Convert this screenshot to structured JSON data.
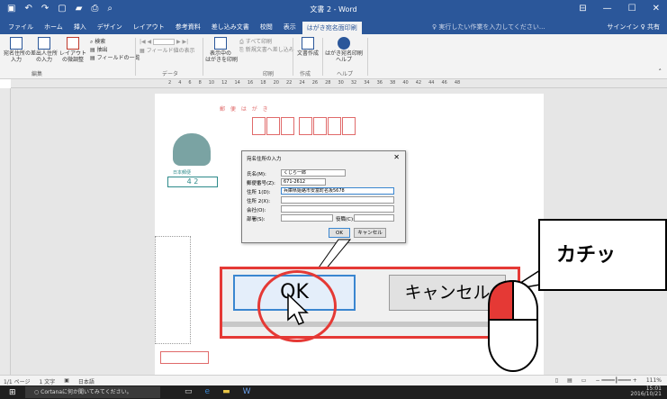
{
  "window": {
    "title": "文書 2 - Word",
    "controls": [
      "⊟",
      "—",
      "☐",
      "✕"
    ]
  },
  "menu": {
    "tabs": [
      "ファイル",
      "ホーム",
      "挿入",
      "デザイン",
      "レイアウト",
      "参考資料",
      "差し込み文書",
      "校閲",
      "表示",
      "はがき宛名面印刷"
    ],
    "active_index": 9,
    "tellme": "♀ 実行したい作業を入力してください...",
    "signin": "サインイン",
    "share": "♀ 共有"
  },
  "ribbon": {
    "btn_address": "宛名住所の\n入力",
    "btn_sender": "差出人住所\nの入力",
    "btn_layout": "レイアウト\nの微調整",
    "search": "検索",
    "extract": "抽出",
    "field_all": "フィールドの一覧",
    "field_display": "フィールド値の表示",
    "show_cards": "表示中の\nはがきを印刷",
    "print_all": "すべて印刷",
    "print_new": "新規文書へ差し込み",
    "doc_create": "文書作成",
    "help": "はがき宛名印刷\nヘルプ",
    "groups": {
      "edit": "編集",
      "data": "データ",
      "print": "印刷",
      "create": "作成",
      "helpg": "ヘルプ"
    }
  },
  "ruler": {
    "ticks": [
      "2",
      "4",
      "6",
      "8",
      "10",
      "12",
      "14",
      "16",
      "18",
      "20",
      "22",
      "24",
      "26",
      "28",
      "30",
      "32",
      "34",
      "36",
      "38",
      "40",
      "42",
      "44",
      "46",
      "48"
    ]
  },
  "page": {
    "postal_label": "郵 便 は が き",
    "stamp_label": "",
    "logo_text": "日本郵便",
    "stamp_value": "4 2"
  },
  "dialog": {
    "title": "宛名住所の入力",
    "labels": [
      "氏名(M):",
      "郵便番号(Z):",
      "住所 1(D):",
      "住所 2(X):",
      "会社(O):",
      "部署(S):"
    ],
    "values": {
      "name": "くじら一郎",
      "zip": "671-2612",
      "addr1": "兵庫県姫路市安富町名坂5678",
      "addr2": "",
      "company": "",
      "dept": ""
    },
    "title_label": "役職(C):",
    "ok": "OK",
    "cancel": "キャンセル"
  },
  "zoom": {
    "ok": "OK",
    "cancel": "キャンセル"
  },
  "callout": {
    "text": "カチッ"
  },
  "status": {
    "page": "1/1 ページ",
    "words": "1 文字",
    "lang": "日本語",
    "zoom": "111%"
  },
  "taskbar": {
    "search": "Cortanaに何か聞いてみてください。",
    "time": "15:01",
    "date": "2016/10/21"
  }
}
